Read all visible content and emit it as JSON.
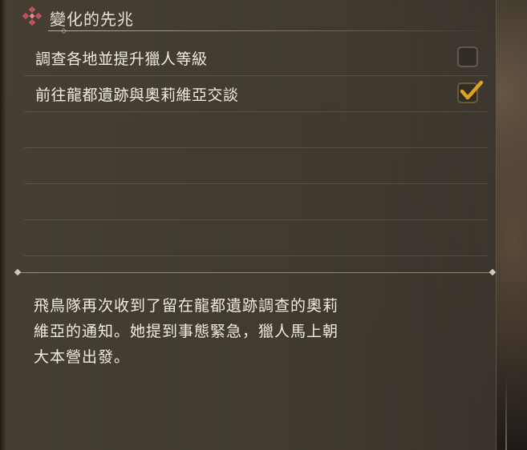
{
  "quest": {
    "title": "變化的先兆"
  },
  "tasks": [
    {
      "label": "調查各地並提升獵人等級",
      "completed": false
    },
    {
      "label": "前往龍都遺跡與奧莉維亞交談",
      "completed": true
    }
  ],
  "description": {
    "line1": "飛鳥隊再次收到了留在龍都遺跡調查的奧莉",
    "line2": "維亞的通知。她提到事態緊急，獵人馬上朝",
    "line3": "大本營出發。"
  },
  "colors": {
    "checkmark": "#e0a020",
    "icon": "#c0505c",
    "text": "#f1ece2"
  },
  "icons": {
    "header": "diamond-cluster-icon",
    "checked": "checkmark-icon"
  }
}
